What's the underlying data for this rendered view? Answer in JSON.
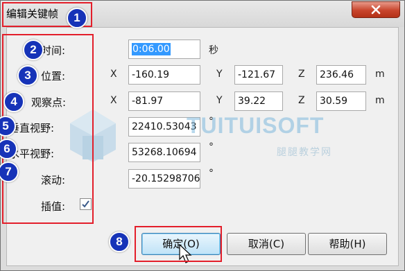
{
  "window": {
    "title": "编辑关键帧"
  },
  "form": {
    "time": {
      "label": "时间:",
      "value": "0:06.00",
      "unit": "秒"
    },
    "position": {
      "label": "位置:",
      "x_label": "X",
      "x": "-160.19",
      "y_label": "Y",
      "y": "-121.67",
      "z_label": "Z",
      "z": "236.46",
      "unit": "m"
    },
    "viewpoint": {
      "label": "观察点:",
      "x_label": "X",
      "x": "-81.97",
      "y_label": "Y",
      "y": "39.22",
      "z_label": "Z",
      "z": "30.59",
      "unit": "m"
    },
    "vertical_fov": {
      "label": "垂直视野:",
      "value": "22410.53043",
      "unit": "°"
    },
    "horizontal_fov": {
      "label": "水平视野:",
      "value": "53268.10694",
      "unit": "°"
    },
    "roll": {
      "label": "滚动:",
      "value": "-20.15298706",
      "unit": "°"
    },
    "interpolate": {
      "label": "插值:",
      "checked": true
    }
  },
  "buttons": {
    "ok": "确定(O)",
    "cancel": "取消(C)",
    "help": "帮助(H)"
  },
  "annotations": [
    "1",
    "2",
    "3",
    "4",
    "5",
    "6",
    "7",
    "8"
  ],
  "watermark": {
    "text": "TUITUISOFT",
    "subtext": "腿腿教学网"
  },
  "colors": {
    "highlight_box": "#e31e2a",
    "badge": "#1633b8",
    "selection": "#3399ff",
    "close_button": "#c8442c"
  }
}
